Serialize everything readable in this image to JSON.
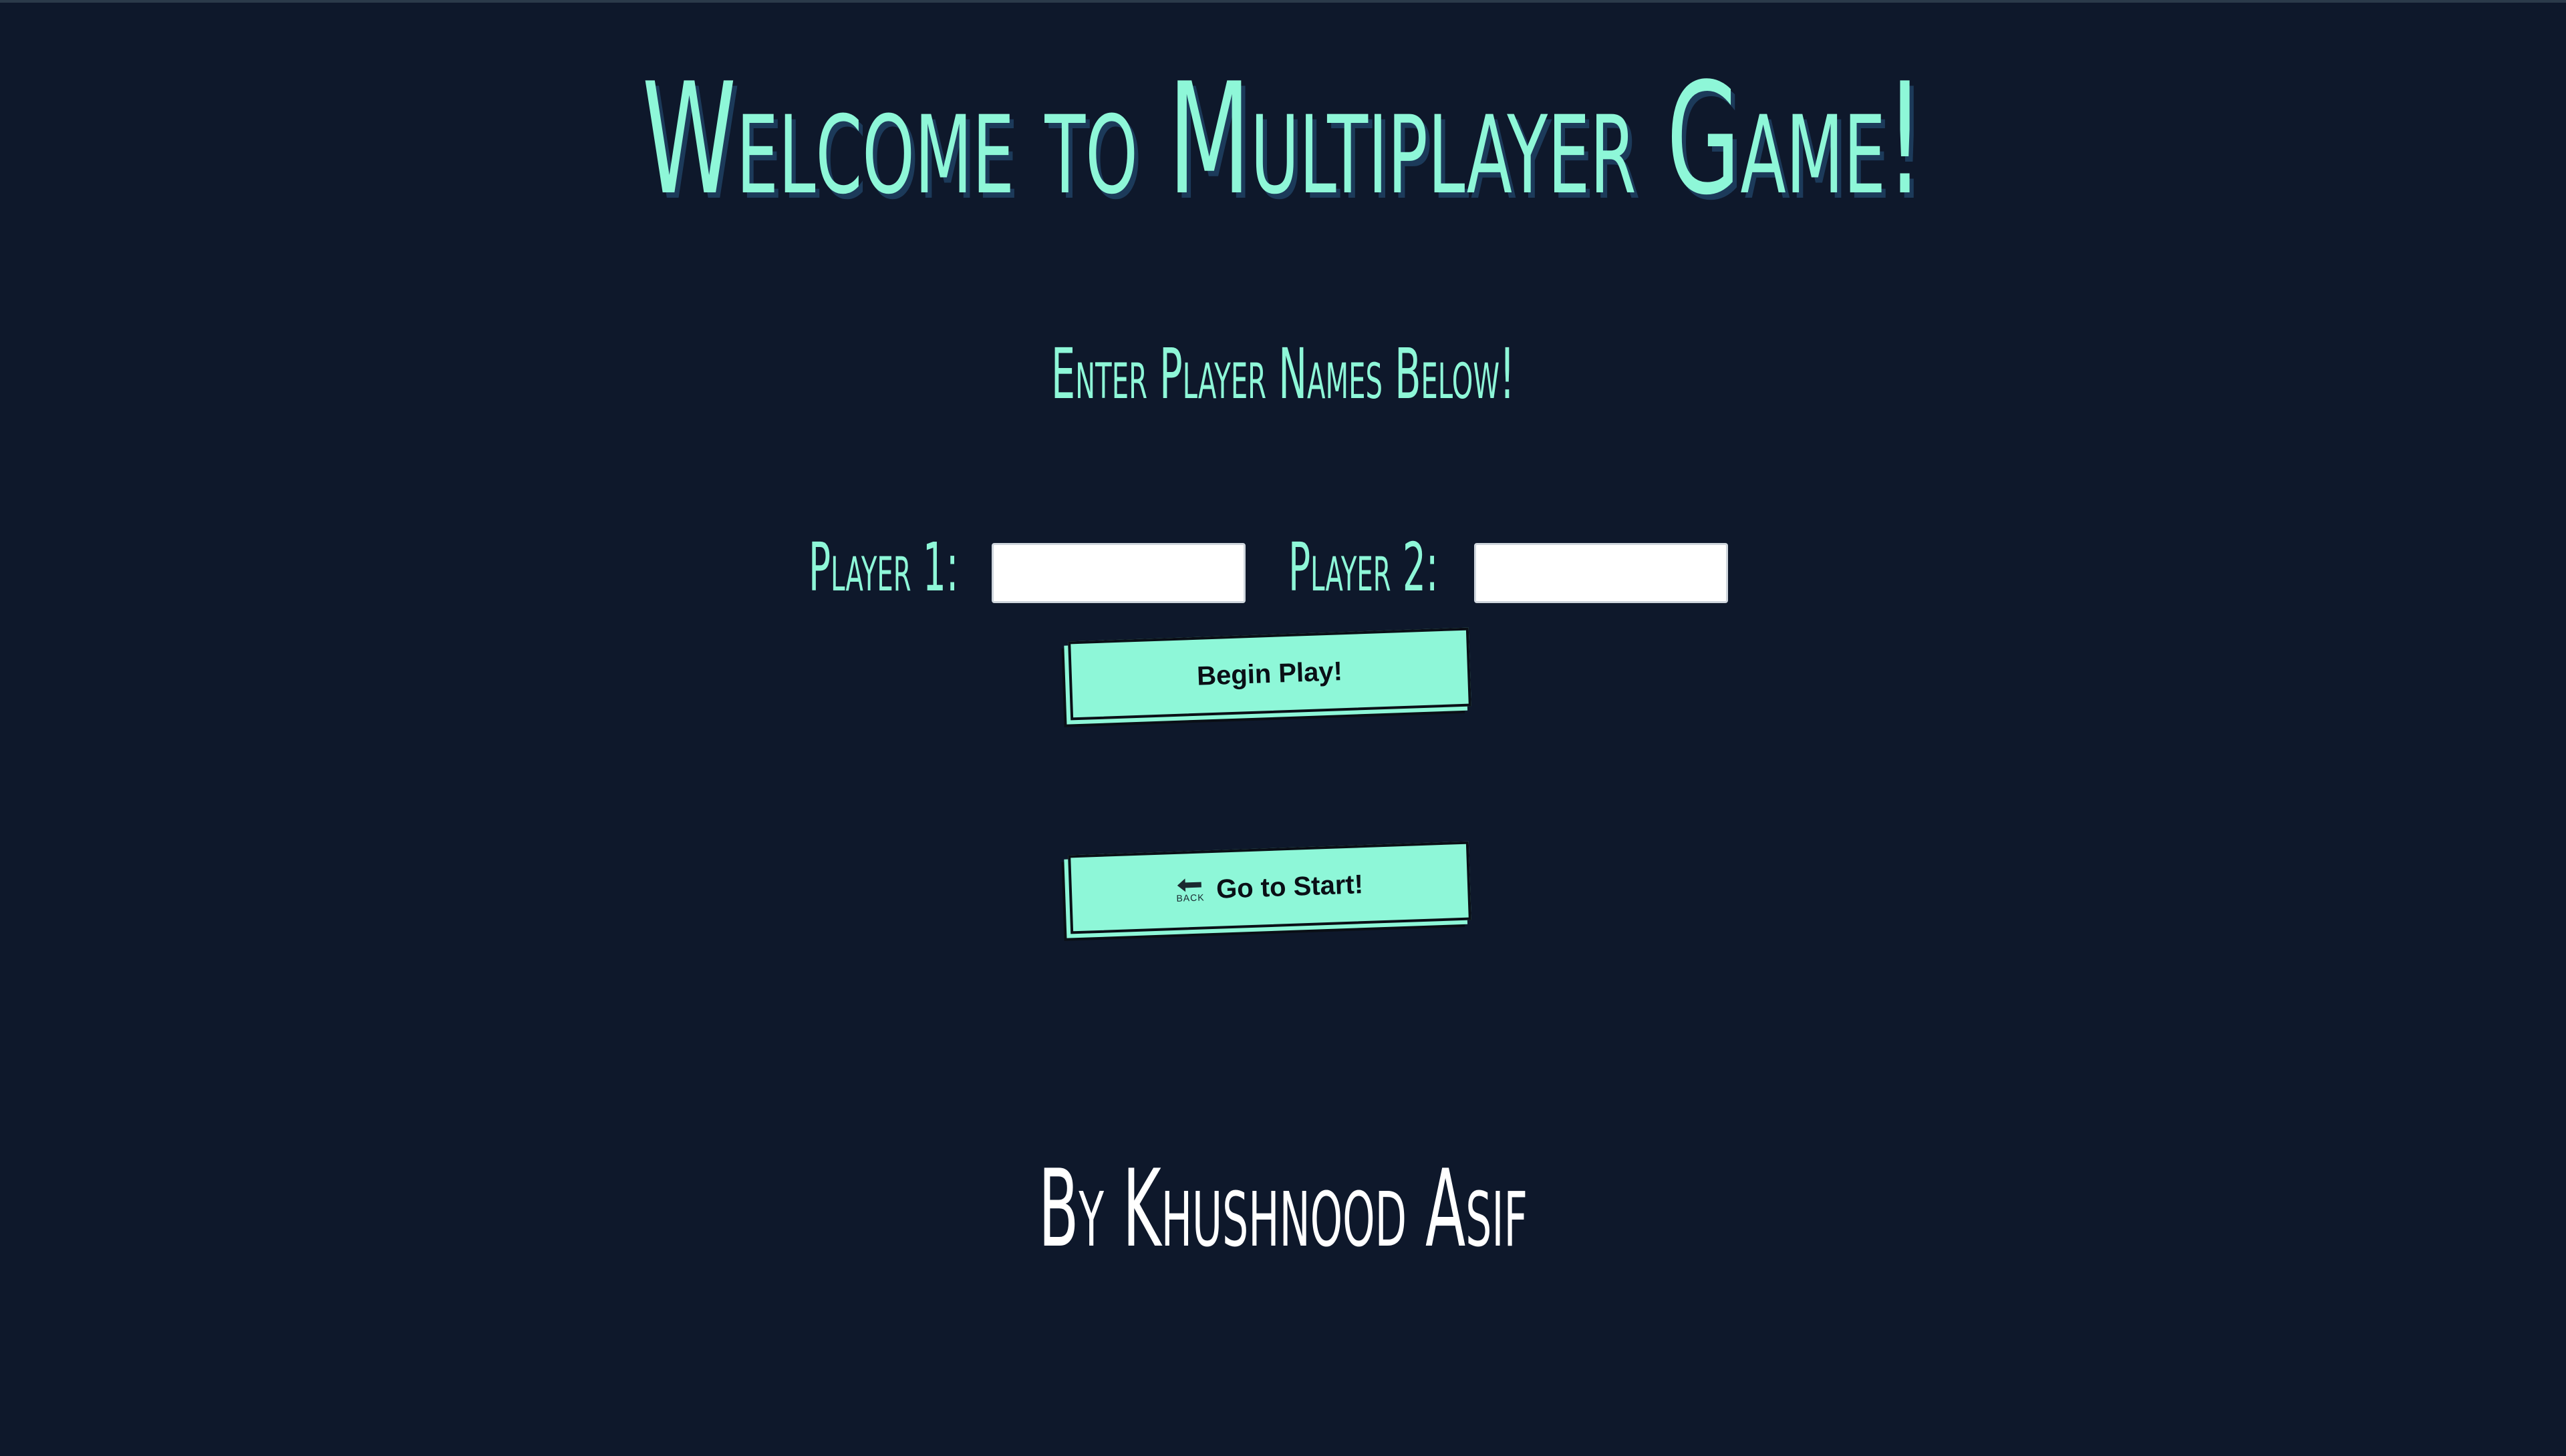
{
  "page": {
    "title": "Welcome to Multiplayer Game!",
    "subtitle": "Enter Player Names Below!",
    "credit": "By Khushnood Asif"
  },
  "players": {
    "player1": {
      "label": "Player 1:",
      "value": ""
    },
    "player2": {
      "label": "Player 2:",
      "value": ""
    }
  },
  "buttons": {
    "begin_label": "Begin Play!",
    "start_label": "Go to Start!",
    "back_icon_text": "BACK"
  },
  "colors": {
    "background": "#0e182b",
    "accent": "#8ef7d8",
    "title_shadow": "#1c3a5a",
    "credit_text": "#ffffff",
    "button_text": "#0a0f16"
  },
  "icons": {
    "back": "back-arrow-icon"
  }
}
